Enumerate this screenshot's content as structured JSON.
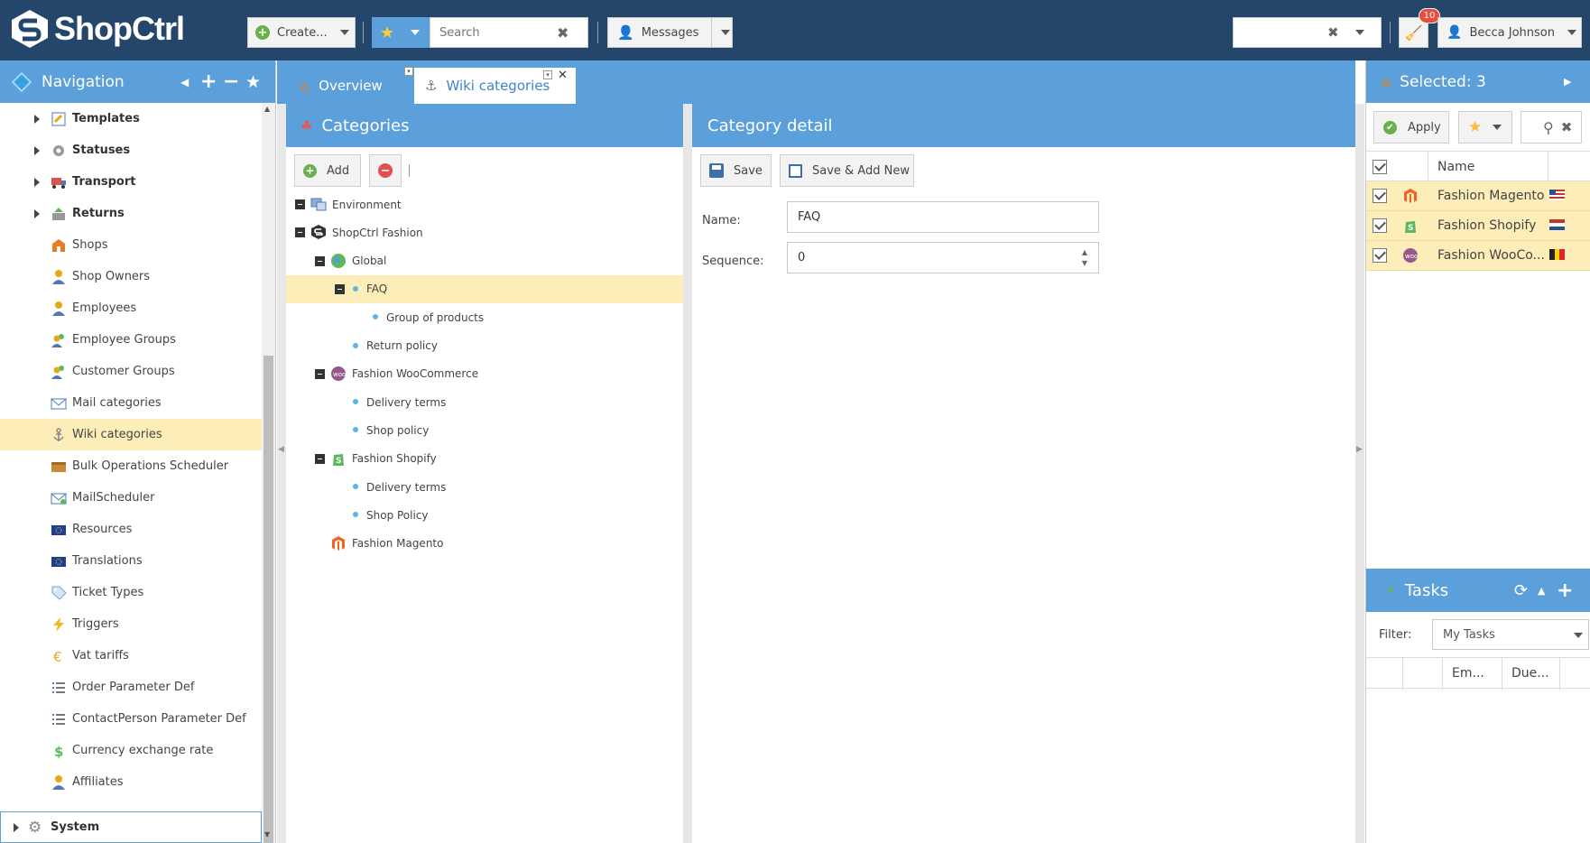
{
  "app": {
    "name": "ShopCtrl"
  },
  "topbar": {
    "create_label": "Create...",
    "search_placeholder": "Search",
    "messages_label": "Messages",
    "notification_count": "10",
    "user_name": "Becca Johnson"
  },
  "nav": {
    "title": "Navigation",
    "items": [
      {
        "label": "Templates",
        "bold": true,
        "icon": "templates-icon"
      },
      {
        "label": "Statuses",
        "bold": true,
        "icon": "gear-icon"
      },
      {
        "label": "Transport",
        "bold": true,
        "icon": "truck-icon"
      },
      {
        "label": "Returns",
        "bold": true,
        "icon": "return-icon"
      },
      {
        "label": "Shops",
        "icon": "shop-icon"
      },
      {
        "label": "Shop Owners",
        "icon": "person-icon"
      },
      {
        "label": "Employees",
        "icon": "person-icon"
      },
      {
        "label": "Employee Groups",
        "icon": "group-icon"
      },
      {
        "label": "Customer Groups",
        "icon": "group-icon"
      },
      {
        "label": "Mail categories",
        "icon": "mail-icon"
      },
      {
        "label": "Wiki categories",
        "icon": "anchor-icon",
        "selected": true
      },
      {
        "label": "Bulk Operations Scheduler",
        "icon": "box-icon"
      },
      {
        "label": "MailScheduler",
        "icon": "mail-scheduler-icon"
      },
      {
        "label": "Resources",
        "icon": "flag-eu-icon"
      },
      {
        "label": "Translations",
        "icon": "flag-eu-icon"
      },
      {
        "label": "Ticket Types",
        "icon": "tag-icon"
      },
      {
        "label": "Triggers",
        "icon": "lightning-icon"
      },
      {
        "label": "Vat tariffs",
        "icon": "euro-icon"
      },
      {
        "label": "Order Parameter Def",
        "icon": "list-icon"
      },
      {
        "label": "ContactPerson Parameter Def",
        "icon": "list-icon"
      },
      {
        "label": "Currency exchange rate",
        "icon": "dollar-icon"
      },
      {
        "label": "Affiliates",
        "icon": "person-icon"
      }
    ],
    "system_label": "System"
  },
  "tabs": [
    {
      "label": "Overview"
    },
    {
      "label": "Wiki categories"
    }
  ],
  "categories": {
    "title": "Categories",
    "add_label": "Add",
    "tree": [
      {
        "label": "Environment",
        "level": 0,
        "expander": true,
        "icon": "environment-icon"
      },
      {
        "label": "ShopCtrl Fashion",
        "level": 0,
        "expander": true,
        "icon": "shopctrl-icon"
      },
      {
        "label": "Global",
        "level": 1,
        "expander": true,
        "icon": "globe-icon"
      },
      {
        "label": "FAQ",
        "level": 2,
        "expander": true,
        "dot": true,
        "selected": true
      },
      {
        "label": "Group of products",
        "level": 3,
        "dot": true
      },
      {
        "label": "Return policy",
        "level": 2,
        "dot": true
      },
      {
        "label": "Fashion WooCommerce",
        "level": 1,
        "expander": true,
        "icon": "woocommerce-icon"
      },
      {
        "label": "Delivery terms",
        "level": 2,
        "dot": true
      },
      {
        "label": "Shop policy",
        "level": 2,
        "dot": true
      },
      {
        "label": "Fashion Shopify",
        "level": 1,
        "expander": true,
        "icon": "shopify-icon"
      },
      {
        "label": "Delivery terms",
        "level": 2,
        "dot": true
      },
      {
        "label": "Shop Policy",
        "level": 2,
        "dot": true
      },
      {
        "label": "Fashion Magento",
        "level": 1,
        "icon": "magento-icon"
      }
    ]
  },
  "detail": {
    "title": "Category detail",
    "save_label": "Save",
    "save_add_label": "Save & Add New",
    "name_label": "Name:",
    "name_value": "FAQ",
    "sequence_label": "Sequence:",
    "sequence_value": "0"
  },
  "selected": {
    "title": "Selected: 3",
    "apply_label": "Apply",
    "col_name": "Name",
    "rows": [
      {
        "name": "Fashion Magento",
        "icon": "magento-icon",
        "flag": "us-flag-icon"
      },
      {
        "name": "Fashion Shopify",
        "icon": "shopify-icon",
        "flag": "nl-flag-icon"
      },
      {
        "name": "Fashion WooCo...",
        "icon": "woocommerce-icon",
        "flag": "be-flag-icon"
      }
    ]
  },
  "tasks": {
    "title": "Tasks",
    "filter_label": "Filter:",
    "filter_value": "My Tasks",
    "col_em": "Em...",
    "col_due": "Due..."
  },
  "colors": {
    "topbar": "#24466b",
    "panel_header": "#5b9fdb",
    "selection": "#fcedb9"
  }
}
